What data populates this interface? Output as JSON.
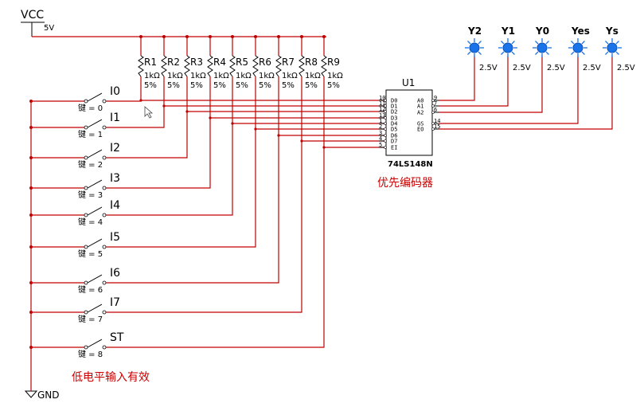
{
  "power": {
    "vcc_label": "VCC",
    "vcc_value": "5V",
    "gnd_label": "GND"
  },
  "resistors": [
    {
      "name": "R1",
      "value": "1kΩ",
      "tol": "5%"
    },
    {
      "name": "R2",
      "value": "1kΩ",
      "tol": "5%"
    },
    {
      "name": "R3",
      "value": "1kΩ",
      "tol": "5%"
    },
    {
      "name": "R4",
      "value": "1kΩ",
      "tol": "5%"
    },
    {
      "name": "R5",
      "value": "1kΩ",
      "tol": "5%"
    },
    {
      "name": "R6",
      "value": "1kΩ",
      "tol": "5%"
    },
    {
      "name": "R7",
      "value": "1kΩ",
      "tol": "5%"
    },
    {
      "name": "R8",
      "value": "1kΩ",
      "tol": "5%"
    },
    {
      "name": "R9",
      "value": "1kΩ",
      "tol": "5%"
    }
  ],
  "switches": [
    {
      "name": "I0",
      "key": "键 = 0"
    },
    {
      "name": "I1",
      "key": "键 = 1"
    },
    {
      "name": "I2",
      "key": "键 = 2"
    },
    {
      "name": "I3",
      "key": "键 = 3"
    },
    {
      "name": "I4",
      "key": "键 = 4"
    },
    {
      "name": "I5",
      "key": "键 = 5"
    },
    {
      "name": "I6",
      "key": "键 = 6"
    },
    {
      "name": "I7",
      "key": "键 = 7"
    },
    {
      "name": "ST",
      "key": "键 = 8"
    }
  ],
  "chip": {
    "ref": "U1",
    "part": "74LS148N",
    "left_pins": [
      "D0",
      "D1",
      "D2",
      "D3",
      "D4",
      "D5",
      "D6",
      "D7",
      "EI"
    ],
    "left_pin_numbers": [
      "10",
      "11",
      "12",
      "13",
      "1",
      "2",
      "3",
      "4",
      "5"
    ],
    "right_pins": [
      "A0",
      "A1",
      "A2",
      "GS",
      "EO"
    ],
    "right_pin_numbers": [
      "9",
      "7",
      "6",
      "14",
      "15"
    ]
  },
  "probes": [
    {
      "name": "Y2",
      "voltage": "2.5V"
    },
    {
      "name": "Y1",
      "voltage": "2.5V"
    },
    {
      "name": "Y0",
      "voltage": "2.5V"
    },
    {
      "name": "Yes",
      "voltage": "2.5V"
    },
    {
      "name": "Ys",
      "voltage": "2.5V"
    }
  ],
  "captions": {
    "encoder": "优先编码器",
    "active_low": "低电平输入有效"
  },
  "colors": {
    "wire": "#c00000",
    "probe": "#1a73e8",
    "caption": "#cc0000"
  }
}
